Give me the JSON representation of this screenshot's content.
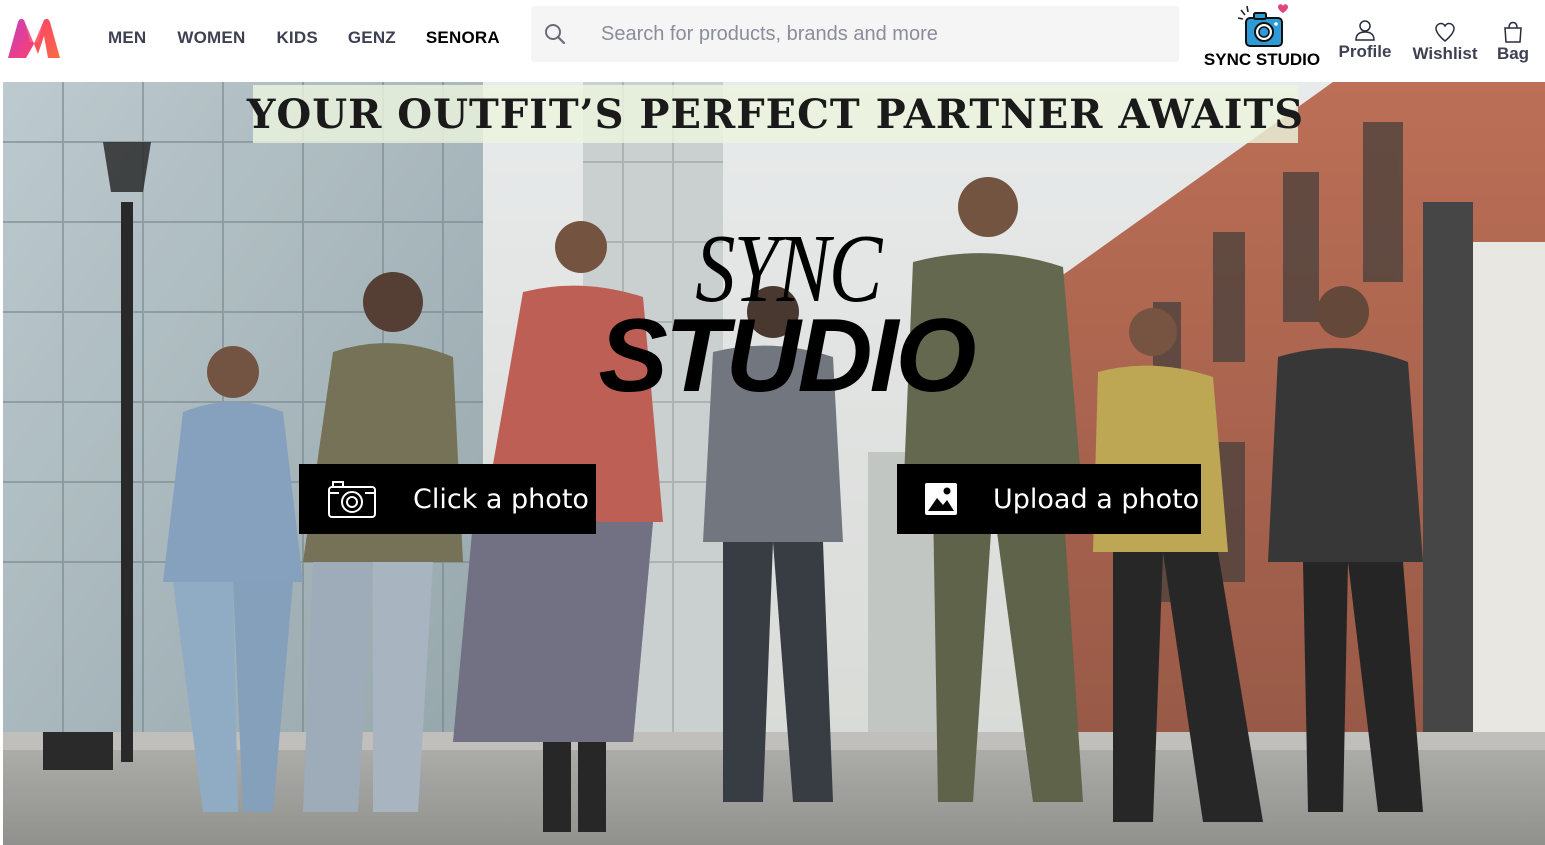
{
  "brand": {
    "logo_icon": "myntra-m-logo",
    "colors": [
      "#ff3f6c",
      "#f96b42",
      "#c33fc1"
    ]
  },
  "nav": [
    {
      "label": "MEN"
    },
    {
      "label": "WOMEN"
    },
    {
      "label": "KIDS"
    },
    {
      "label": "GENZ"
    },
    {
      "label": "SENORA"
    }
  ],
  "search": {
    "placeholder": "Search for products, brands and more",
    "icon": "search-icon"
  },
  "actions": {
    "sync_studio": {
      "label": "SYNC STUDIO",
      "icon": "camera-icon"
    },
    "profile": {
      "label": "Profile",
      "icon": "user-icon"
    },
    "wishlist": {
      "label": "Wishlist",
      "icon": "heart-icon"
    },
    "bag": {
      "label": "Bag",
      "icon": "bag-icon"
    }
  },
  "hero": {
    "tagline": "YOUR OUTFIT’S PERFECT PARTNER AWAITS",
    "logo_line1": "SYNC",
    "logo_line2": "STUDIO",
    "click_label": "Click a photo",
    "upload_label": "Upload a photo"
  }
}
